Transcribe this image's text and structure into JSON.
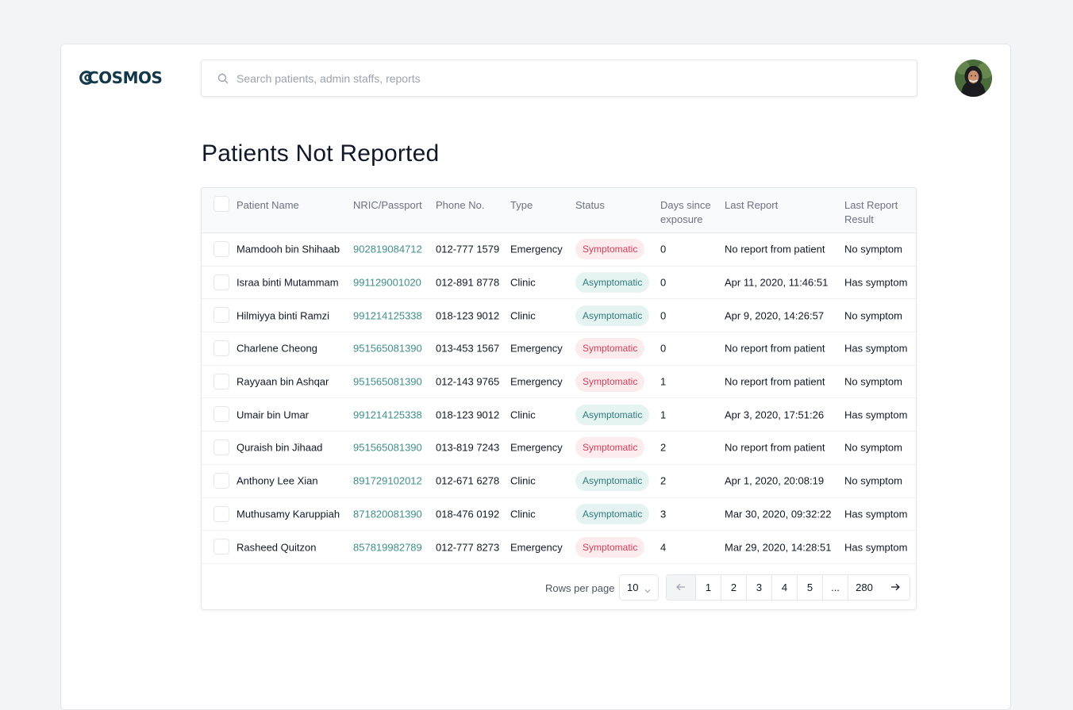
{
  "brand": {
    "logo_text": "COSMOS"
  },
  "search": {
    "placeholder": "Search patients, admin staffs, reports"
  },
  "header": {
    "avatar_icon": "user-avatar"
  },
  "page": {
    "title": "Patients Not Reported"
  },
  "table": {
    "columns": {
      "patient_name": "Patient Name",
      "nric": "NRIC/Passport",
      "phone": "Phone No.",
      "type": "Type",
      "status": "Status",
      "days_line1": "Days since",
      "days_line2": "exposure",
      "last_report": "Last Report",
      "result_line1": "Last Report",
      "result_line2": "Result"
    },
    "rows": [
      {
        "name": "Mamdooh bin Shihaab",
        "nric": "902819084712",
        "phone": "012-777 1579",
        "type": "Emergency",
        "status": "Symptomatic",
        "days": "0",
        "last_report": "No report from patient",
        "result": "No symptom"
      },
      {
        "name": "Israa binti Mutammam",
        "nric": "991129001020",
        "phone": "012-891 8778",
        "type": "Clinic",
        "status": "Asymptomatic",
        "days": "0",
        "last_report": "Apr 11, 2020, 11:46:51",
        "result": "Has symptom"
      },
      {
        "name": "Hilmiyya binti Ramzi",
        "nric": "991214125338",
        "phone": "018-123 9012",
        "type": "Clinic",
        "status": "Asymptomatic",
        "days": "0",
        "last_report": "Apr 9, 2020, 14:26:57",
        "result": "No symptom"
      },
      {
        "name": "Charlene Cheong",
        "nric": "951565081390",
        "phone": "013-453 1567",
        "type": "Emergency",
        "status": "Symptomatic",
        "days": "0",
        "last_report": "No report from patient",
        "result": "Has symptom"
      },
      {
        "name": "Rayyaan bin Ashqar",
        "nric": "951565081390",
        "phone": "012-143 9765",
        "type": "Emergency",
        "status": "Symptomatic",
        "days": "1",
        "last_report": "No report from patient",
        "result": "No symptom"
      },
      {
        "name": "Umair bin Umar",
        "nric": "991214125338",
        "phone": "018-123 9012",
        "type": "Clinic",
        "status": "Asymptomatic",
        "days": "1",
        "last_report": "Apr 3, 2020, 17:51:26",
        "result": "Has symptom"
      },
      {
        "name": "Quraish bin Jihaad",
        "nric": "951565081390",
        "phone": "013-819 7243",
        "type": "Emergency",
        "status": "Symptomatic",
        "days": "2",
        "last_report": "No report from patient",
        "result": "No symptom"
      },
      {
        "name": "Anthony Lee Xian",
        "nric": "891729102012",
        "phone": "012-671 6278",
        "type": "Clinic",
        "status": "Asymptomatic",
        "days": "2",
        "last_report": "Apr 1, 2020, 20:08:19",
        "result": "No symptom"
      },
      {
        "name": "Muthusamy Karuppiah",
        "nric": "871820081390",
        "phone": "018-476 0192",
        "type": "Clinic",
        "status": "Asymptomatic",
        "days": "3",
        "last_report": "Mar 30, 2020, 09:32:22",
        "result": "Has symptom"
      },
      {
        "name": "Rasheed Quitzon",
        "nric": "857819982789",
        "phone": "012-777 8273",
        "type": "Emergency",
        "status": "Symptomatic",
        "days": "4",
        "last_report": "Mar 29, 2020, 14:28:51",
        "result": "Has symptom"
      }
    ]
  },
  "pagination": {
    "rows_per_page_label": "Rows per page",
    "rows_per_page_value": "10",
    "prev_icon": "arrow-left-icon",
    "next_icon": "arrow-right-icon",
    "pages": [
      "1",
      "2",
      "3",
      "4",
      "5",
      "...",
      "280"
    ]
  },
  "colors": {
    "accent_link": "#3f8f8c",
    "symptomatic_bg": "#fdecee",
    "symptomatic_text": "#d63b55",
    "asymptomatic_bg": "#e5f3f3",
    "asymptomatic_text": "#2f7b7c",
    "brand": "#12384a"
  }
}
